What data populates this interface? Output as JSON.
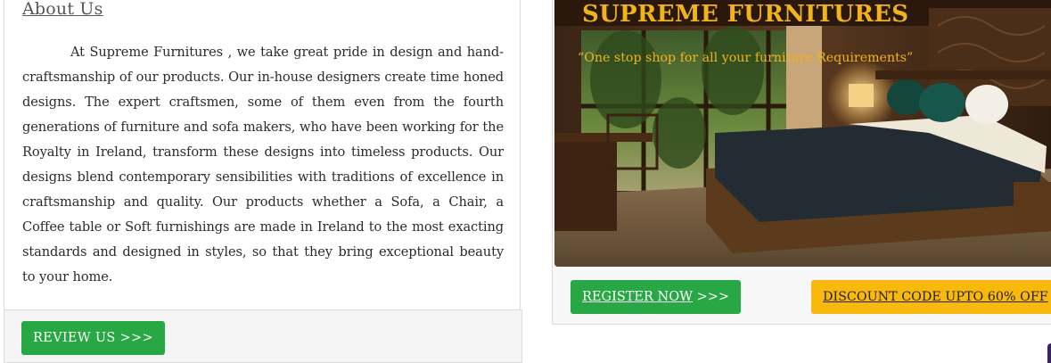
{
  "about": {
    "title": "About Us",
    "body": "At Supreme Furnitures , we take great pride in design and hand-craftsmanship of our products. Our in-house designers create time honed designs. The expert craftsmen, some of them even from the fourth generations of furniture and sofa makers, who have been working for the Royalty in Ireland, transform these designs into timeless products. Our designs blend contemporary sensibilities with traditions of excellence in craftsmanship and quality. Our products whether a Sofa, a Chair, a Coffee table or Soft furnishings are made in Ireland to the most exacting standards and designed in styles, so that they bring exceptional beauty to your home.",
    "review_button": "REVIEW US >>>"
  },
  "hero": {
    "title": "SUPREME FURNITURES",
    "tagline": "“One stop shop for all your furniture Requirements”",
    "image_icon": "bedroom-photo",
    "register_label": "REGISTER NOW",
    "register_suffix": " >>>",
    "discount_label": "DISCOUNT CODE UPTO 60% OFF"
  },
  "colors": {
    "green": "#28a745",
    "gold": "#f2b21c",
    "yellow": "#f9b90c"
  }
}
